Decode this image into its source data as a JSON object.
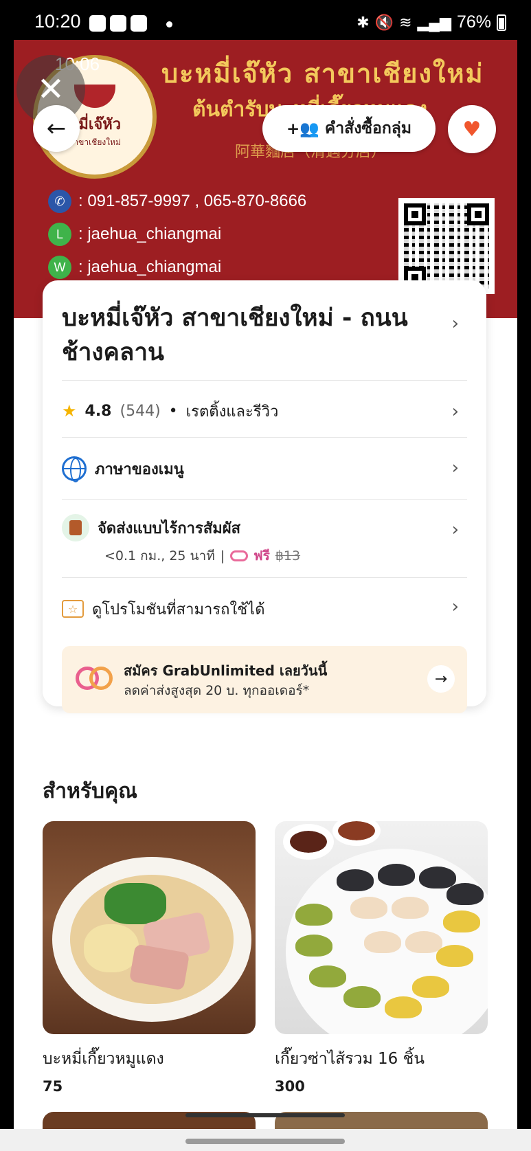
{
  "status_bar": {
    "time": "10:20",
    "battery": "76%"
  },
  "overlay": {
    "clock": "10:06"
  },
  "banner": {
    "title_thai": "บะหมี่เจ๊หัว สาขาเชียงใหม่",
    "subtitle_thai": "ต้นตำรับบะหมี่เกี๊ยวหมูแดง",
    "chinese": "阿華麵店（清邁分店）",
    "logo_text": "หมี่เจ๊หัว",
    "logo_sub": "สาขาเชียงใหม่",
    "phone": ": 091-857-9997 , 065-870-8666",
    "line": ": jaehua_chiangmai",
    "wechat": ": jaehua_chiangmai"
  },
  "header": {
    "group_order_label": "คำสั่งซื้อกลุ่ม"
  },
  "restaurant": {
    "name": "บะหมี่เจ๊หัว สาขาเชียงใหม่ - ถนนช้างคลาน",
    "rating": "4.8",
    "rating_count": "(544)",
    "rating_label": "เรตติ้งและรีวิว",
    "menu_language": "ภาษาของเมนู",
    "delivery_title": "จัดส่งแบบไร้การสัมผัส",
    "delivery_distance": "<0.1 กม., 25 นาที",
    "delivery_free": "ฟรี",
    "delivery_old_price": "฿13",
    "promotions": "ดูโปรโมชันที่สามารถใช้ได้"
  },
  "grab_unlimited": {
    "title": "สมัคร GrabUnlimited เลยวันนี้",
    "subtitle": "ลดค่าส่งสูงสุด 20 บ. ทุกออเดอร์*"
  },
  "for_you": {
    "title": "สำหรับคุณ",
    "items": [
      {
        "name": "บะหมี่เกี๊ยวหมูแดง",
        "price": "75"
      },
      {
        "name": "เกี๊ยวซ่าไส้รวม 16 ชิ้น",
        "price": "300"
      }
    ]
  },
  "colors": {
    "banner_red": "#9d1e22",
    "gold": "#f3c95c",
    "heart": "#f0562d",
    "grab_pink": "#d0478a"
  },
  "icons": [
    "close-icon",
    "back-arrow-icon",
    "group-add-icon",
    "heart-icon",
    "star-icon",
    "globe-icon",
    "contactless-icon",
    "promo-ticket-icon",
    "grab-unlimited-icon",
    "arrow-right-icon",
    "chevron-right-icon"
  ]
}
